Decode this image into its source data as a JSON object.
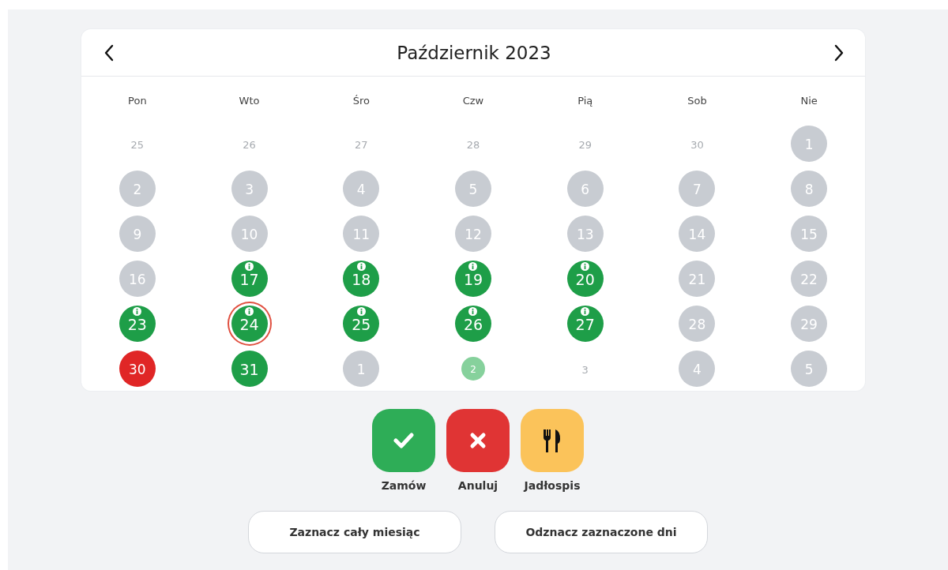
{
  "calendar": {
    "title": "Październik 2023",
    "weekdays": [
      "Pon",
      "Wto",
      "Śro",
      "Czw",
      "Pią",
      "Sob",
      "Nie"
    ],
    "days": [
      {
        "day": "25",
        "kind": "plain",
        "info": false,
        "today": false
      },
      {
        "day": "26",
        "kind": "plain",
        "info": false,
        "today": false
      },
      {
        "day": "27",
        "kind": "plain",
        "info": false,
        "today": false
      },
      {
        "day": "28",
        "kind": "plain",
        "info": false,
        "today": false
      },
      {
        "day": "29",
        "kind": "plain",
        "info": false,
        "today": false
      },
      {
        "day": "30",
        "kind": "plain",
        "info": false,
        "today": false
      },
      {
        "day": "1",
        "kind": "unavailable",
        "info": false,
        "today": false
      },
      {
        "day": "2",
        "kind": "unavailable",
        "info": false,
        "today": false
      },
      {
        "day": "3",
        "kind": "unavailable",
        "info": false,
        "today": false
      },
      {
        "day": "4",
        "kind": "unavailable",
        "info": false,
        "today": false
      },
      {
        "day": "5",
        "kind": "unavailable",
        "info": false,
        "today": false
      },
      {
        "day": "6",
        "kind": "unavailable",
        "info": false,
        "today": false
      },
      {
        "day": "7",
        "kind": "unavailable",
        "info": false,
        "today": false
      },
      {
        "day": "8",
        "kind": "unavailable",
        "info": false,
        "today": false
      },
      {
        "day": "9",
        "kind": "unavailable",
        "info": false,
        "today": false
      },
      {
        "day": "10",
        "kind": "unavailable",
        "info": false,
        "today": false
      },
      {
        "day": "11",
        "kind": "unavailable",
        "info": false,
        "today": false
      },
      {
        "day": "12",
        "kind": "unavailable",
        "info": false,
        "today": false
      },
      {
        "day": "13",
        "kind": "unavailable",
        "info": false,
        "today": false
      },
      {
        "day": "14",
        "kind": "unavailable",
        "info": false,
        "today": false
      },
      {
        "day": "15",
        "kind": "unavailable",
        "info": false,
        "today": false
      },
      {
        "day": "16",
        "kind": "unavailable",
        "info": false,
        "today": false
      },
      {
        "day": "17",
        "kind": "ordered",
        "info": true,
        "today": false
      },
      {
        "day": "18",
        "kind": "ordered",
        "info": true,
        "today": false
      },
      {
        "day": "19",
        "kind": "ordered",
        "info": true,
        "today": false
      },
      {
        "day": "20",
        "kind": "ordered",
        "info": true,
        "today": false
      },
      {
        "day": "21",
        "kind": "unavailable",
        "info": false,
        "today": false
      },
      {
        "day": "22",
        "kind": "unavailable",
        "info": false,
        "today": false
      },
      {
        "day": "23",
        "kind": "ordered",
        "info": true,
        "today": false
      },
      {
        "day": "24",
        "kind": "ordered",
        "info": true,
        "today": true
      },
      {
        "day": "25",
        "kind": "ordered",
        "info": true,
        "today": false
      },
      {
        "day": "26",
        "kind": "ordered",
        "info": true,
        "today": false
      },
      {
        "day": "27",
        "kind": "ordered",
        "info": true,
        "today": false
      },
      {
        "day": "28",
        "kind": "unavailable",
        "info": false,
        "today": false
      },
      {
        "day": "29",
        "kind": "unavailable",
        "info": false,
        "today": false
      },
      {
        "day": "30",
        "kind": "cancelled",
        "info": false,
        "today": false
      },
      {
        "day": "31",
        "kind": "ordered",
        "info": false,
        "today": false
      },
      {
        "day": "1",
        "kind": "unavailable",
        "info": false,
        "today": false
      },
      {
        "day": "2",
        "kind": "pending",
        "info": false,
        "today": false
      },
      {
        "day": "3",
        "kind": "plain",
        "info": false,
        "today": false
      },
      {
        "day": "4",
        "kind": "unavailable",
        "info": false,
        "today": false
      },
      {
        "day": "5",
        "kind": "unavailable",
        "info": false,
        "today": false
      }
    ]
  },
  "actions": [
    {
      "kind": "order",
      "label": "Zamów"
    },
    {
      "kind": "cancel",
      "label": "Anuluj"
    },
    {
      "kind": "menu",
      "label": "Jadłospis"
    }
  ],
  "buttons": [
    "Zaznacz cały miesiąc",
    "Odznacz zaznaczone dni"
  ]
}
